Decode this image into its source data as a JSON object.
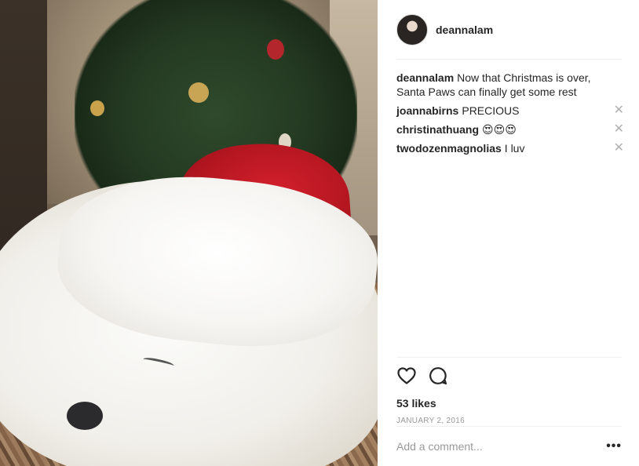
{
  "post": {
    "author": "deannalam",
    "caption": "Now that Christmas is over, Santa Paws can finally get some rest",
    "likes_text": "53 likes",
    "date": "JANUARY 2, 2016"
  },
  "comments": [
    {
      "user": "joannabirns",
      "text": "PRECIOUS"
    },
    {
      "user": "christinathuang",
      "text": "😍😍😍"
    },
    {
      "user": "twodozenmagnolias",
      "text": "I luv"
    }
  ],
  "actions": {
    "like_icon": "heart-icon",
    "comment_icon": "speech-bubble-icon",
    "delete_icon": "close-icon",
    "more_icon": "more-options-icon",
    "more_label": "•••"
  },
  "composer": {
    "placeholder": "Add a comment..."
  },
  "colors": {
    "text": "#262626",
    "muted": "#999999",
    "divider": "#efefef",
    "hat_red": "#c41a25"
  }
}
